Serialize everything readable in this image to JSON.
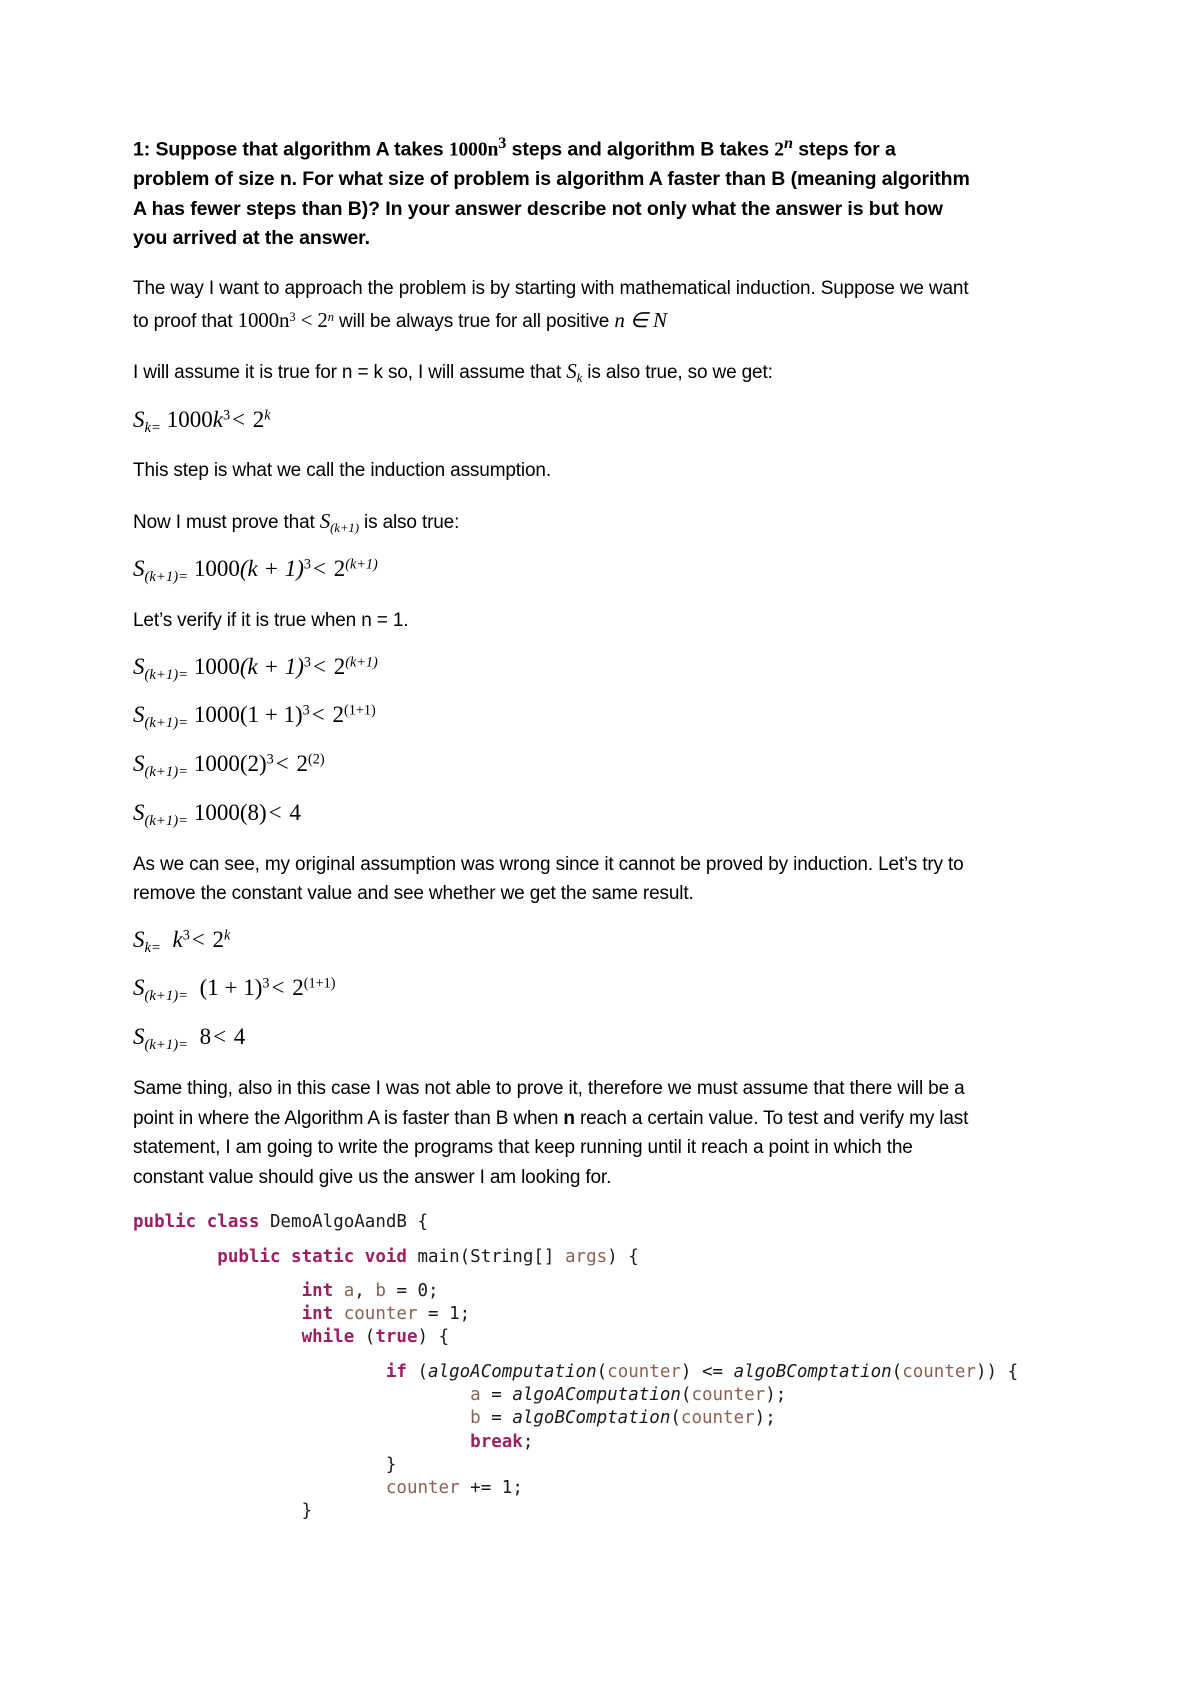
{
  "document": {
    "question": {
      "prefix": "1: Suppose that algorithm A takes ",
      "expr1_base": "1000n",
      "expr1_exp": "3",
      "mid1": " steps and algorithm B takes ",
      "expr2_base": "2",
      "expr2_exp": "n",
      "rest": " steps for a problem of size n. For what size of problem is algorithm A faster than B (meaning algorithm A has fewer steps than B)?  In your answer describe not only what the answer is but how you arrived at the answer."
    },
    "paragraphs": {
      "p1_a": "The way I want to approach the problem is by starting with mathematical induction. Suppose we want to proof that ",
      "p1_math1_base": "1000n",
      "p1_math1_exp": "3",
      "p1_math_lt": " < ",
      "p1_math2_base": "2",
      "p1_math2_exp": "n",
      "p1_b": " will be always true for all positive ",
      "p1_math3": "n ∈ N",
      "p2_a": "I will assume it is true for n = k so, I will assume that ",
      "p2_sym": "S",
      "p2_sym_sub": "k",
      "p2_b": " is also true, so we get:",
      "p3": "This step is what we call the induction assumption.",
      "p4_a": "Now I must prove that ",
      "p4_sym": "S",
      "p4_sym_sub": "(k+1)",
      "p4_b": " is also true:",
      "p5": "Let’s verify if it is true when n = 1.",
      "p6": "As we can see, my original assumption was wrong since it cannot be proved by induction. Let’s try to remove the constant value and see whether we get the same result.",
      "p7_a": "Same thing, also in this case I was not able to prove it, therefore we must assume that there will be a point in where the Algorithm A is faster than B when ",
      "p7_bold": "n",
      "p7_b": " reach a certain value. To test and verify my last statement, I am going to write the programs that keep running until it reach a point in which the constant value should give us the answer I am looking for."
    },
    "equations": [
      {
        "id": "eq1",
        "label": "S",
        "label_sub": "k=",
        "body": "1000k³ < 2^k",
        "parts": {
          "coef": "1000",
          "var": "k",
          "pow": "3",
          "op": "<",
          "rhs_base": "2",
          "rhs_exp": "k"
        }
      },
      {
        "id": "eq2",
        "label": "S",
        "label_sub": "(k+1)=",
        "body": "1000(k + 1)³ < 2^(k+1)",
        "parts": {
          "coef": "1000",
          "inner": "(k + 1)",
          "pow": "3",
          "op": "<",
          "rhs_base": "2",
          "rhs_exp": "(k+1)"
        }
      },
      {
        "id": "eq3",
        "label": "S",
        "label_sub": "(k+1)=",
        "body": "1000(k + 1)³ < 2^(k+1)",
        "parts": {
          "coef": "1000",
          "inner": "(k + 1)",
          "pow": "3",
          "op": "<",
          "rhs_base": "2",
          "rhs_exp": "(k+1)"
        }
      },
      {
        "id": "eq4",
        "label": "S",
        "label_sub": "(k+1)=",
        "body": "1000(1 + 1)³ < 2^(1+1)",
        "parts": {
          "coef": "1000",
          "inner": "(1 + 1)",
          "pow": "3",
          "op": "<",
          "rhs_base": "2",
          "rhs_exp": "(1+1)"
        }
      },
      {
        "id": "eq5",
        "label": "S",
        "label_sub": "(k+1)=",
        "body": "1000(2)³ < 2^(2)",
        "parts": {
          "coef": "1000",
          "inner": "(2)",
          "pow": "3",
          "op": "<",
          "rhs_base": "2",
          "rhs_exp": "(2)"
        }
      },
      {
        "id": "eq6",
        "label": "S",
        "label_sub": "(k+1)=",
        "body": "1000(8) < 4",
        "parts": {
          "coef": "1000",
          "inner": "(8)",
          "op": "<",
          "rhs_base": "4"
        }
      },
      {
        "id": "eq7",
        "label": "S",
        "label_sub": "k=",
        "body": "k³ < 2^k",
        "parts": {
          "var": "k",
          "pow": "3",
          "op": "<",
          "rhs_base": "2",
          "rhs_exp": "k"
        }
      },
      {
        "id": "eq8",
        "label": "S",
        "label_sub": "(k+1)=",
        "body": "(1 + 1)³ < 2^(1+1)",
        "parts": {
          "inner": "(1 + 1)",
          "pow": "3",
          "op": "<",
          "rhs_base": "2",
          "rhs_exp": "(1+1)"
        }
      },
      {
        "id": "eq9",
        "label": "S",
        "label_sub": "(k+1)=",
        "body": "8 < 4",
        "parts": {
          "lhs": "8",
          "op": "<",
          "rhs_base": "4"
        }
      }
    ],
    "code": {
      "language": "java",
      "class_name": "DemoAlgoAandB",
      "lines": [
        "public class DemoAlgoAandB {",
        "",
        "        public static void main(String[] args) {",
        "",
        "                int a, b = 0;",
        "                int counter = 1;",
        "                while (true) {",
        "",
        "                        if (algoAComputation(counter) <= algoBComptation(counter)) {",
        "                                a = algoAComputation(counter);",
        "                                b = algoBComptation(counter);",
        "                                break;",
        "                        }",
        "                        counter += 1;",
        "                }"
      ],
      "colors": {
        "keyword": "#9c1f63",
        "identifier": "#8a6254",
        "plain": "#1a1a1a"
      }
    }
  }
}
